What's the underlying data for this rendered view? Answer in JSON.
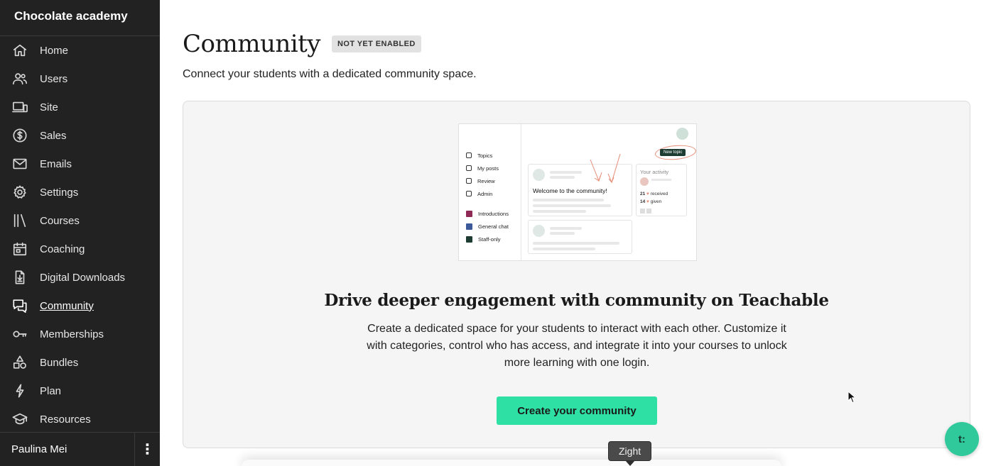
{
  "sidebar": {
    "school_name": "Chocolate academy",
    "items": [
      {
        "label": "Home",
        "icon": "home-icon"
      },
      {
        "label": "Users",
        "icon": "users-icon"
      },
      {
        "label": "Site",
        "icon": "devices-icon"
      },
      {
        "label": "Sales",
        "icon": "dollar-icon"
      },
      {
        "label": "Emails",
        "icon": "mail-icon"
      },
      {
        "label": "Settings",
        "icon": "gear-icon"
      },
      {
        "label": "Courses",
        "icon": "library-icon"
      },
      {
        "label": "Coaching",
        "icon": "calendar-icon"
      },
      {
        "label": "Digital Downloads",
        "icon": "download-file-icon"
      },
      {
        "label": "Community",
        "icon": "chat-bubbles-icon",
        "active": true
      },
      {
        "label": "Memberships",
        "icon": "key-icon"
      },
      {
        "label": "Bundles",
        "icon": "shapes-icon"
      },
      {
        "label": "Plan",
        "icon": "lightning-icon"
      },
      {
        "label": "Resources",
        "icon": "graduation-cap-icon"
      }
    ],
    "user_name": "Paulina Mei",
    "user_menu_glyph": "⋮"
  },
  "page": {
    "title": "Community",
    "badge": "NOT YET ENABLED",
    "subtitle": "Connect your students with a dedicated community space."
  },
  "illustration": {
    "nav": [
      "Topics",
      "My posts",
      "Review",
      "Admin"
    ],
    "categories": [
      {
        "label": "Introductions",
        "color": "#8e2a55"
      },
      {
        "label": "General chat",
        "color": "#3c5a9a"
      },
      {
        "label": "Staff-only",
        "color": "#1d3d33"
      }
    ],
    "new_topic": "New topic",
    "welcome_post": "Welcome to the community!",
    "activity_title": "Your activity",
    "received_count": "21",
    "received_label": "received",
    "given_count": "14",
    "given_label": "given"
  },
  "promo": {
    "headline": "Drive deeper engagement with community on Teachable",
    "description": "Create a dedicated space for your students to interact with each other. Customize it with categories, control who has access, and integrate it into your courses to unlock more learning with one login.",
    "cta_label": "Create your community"
  },
  "overlay": {
    "chat_fab_label": "t:",
    "tooltip": "Zight"
  },
  "colors": {
    "sidebar_bg": "#222222",
    "accent": "#2fe0a4",
    "fab": "#2fc99c"
  }
}
